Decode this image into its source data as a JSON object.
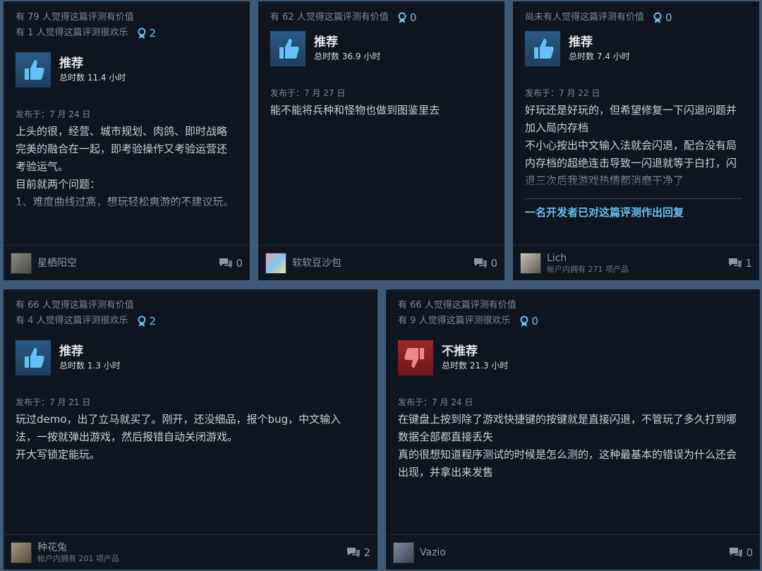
{
  "colors": {
    "page_bg": "#3d5a78",
    "card_bg": "#0f151f",
    "accent": "#66c0f4",
    "recommend_thumb": "#2b5a85",
    "not_recommend_thumb": "#a0262a"
  },
  "reviews": [
    {
      "helpful": "有 79 人觉得这篇评测有价值",
      "funny": "有 1 人觉得这篇评测很欢乐",
      "awards": "2",
      "verdict": "推荐",
      "verdict_icon": "thumbs-up-icon",
      "hours": "总时数 11.4 小时",
      "posted": "发布于：7 月 24 日",
      "paragraphs": [
        "上头的很，经营、城市规划、肉鸽、即时战略完美的融合在一起，即考验操作又考验运营还考验运气。",
        "目前就两个问题：",
        "1、难度曲线过高，想玩轻松爽游的不建议玩。"
      ],
      "user": "星栖阳空",
      "products": "",
      "comments": "0"
    },
    {
      "helpful": "有 62 人觉得这篇评测有价值",
      "funny": "",
      "awards": "0",
      "verdict": "推荐",
      "verdict_icon": "thumbs-up-icon",
      "hours": "总时数 36.9 小时",
      "posted": "发布于：7 月 27 日",
      "paragraphs": [
        "能不能将兵种和怪物也做到图鉴里去"
      ],
      "user": "软软豆沙包",
      "products": "",
      "comments": "0"
    },
    {
      "helpful": "尚未有人觉得这篇评测有价值",
      "funny": "",
      "awards": "0",
      "verdict": "推荐",
      "verdict_icon": "thumbs-up-icon",
      "hours": "总时数 7.4 小时",
      "posted": "发布于：7 月 22 日",
      "paragraphs": [
        "好玩还是好玩的，但希望修复一下闪退问题并加入局内存档",
        "不小心按出中文输入法就会闪退，配合没有局内存档的超绝连击导致一闪退就等于白打，闪退三次后我游戏热情都消磨干净了"
      ],
      "dev_reply": "一名开发者已对这篇评测作出回复",
      "user": "Lich",
      "products": "帐户内拥有 271 项产品",
      "comments": "1"
    },
    {
      "helpful": "有 66 人觉得这篇评测有价值",
      "funny": "有 4 人觉得这篇评测很欢乐",
      "awards": "2",
      "verdict": "推荐",
      "verdict_icon": "thumbs-up-icon",
      "hours": "总时数 1.3 小时",
      "posted": "发布于：7 月 21 日",
      "paragraphs": [
        "玩过demo，出了立马就买了。刚开，还没细品，报个bug，中文输入法，一按就弹出游戏，然后报错自动关闭游戏。",
        "开大写锁定能玩。"
      ],
      "user": "种花兔",
      "products": "帐户内拥有 201 项产品",
      "comments": "2"
    },
    {
      "helpful": "有 66 人觉得这篇评测有价值",
      "funny": "有 9 人觉得这篇评测很欢乐",
      "awards": "0",
      "verdict": "不推荐",
      "verdict_icon": "thumbs-down-icon",
      "hours": "总时数 21.3 小时",
      "posted": "发布于：7 月 24 日",
      "paragraphs": [
        "在键盘上按到除了游戏快捷键的按键就是直接闪退，不管玩了多久打到哪数据全部都直接丢失",
        "真的很想知道程序测试的时候是怎么测的，这种最基本的错误为什么还会出现，并拿出来发售"
      ],
      "user": "Vazio",
      "products": "",
      "comments": "0"
    }
  ]
}
